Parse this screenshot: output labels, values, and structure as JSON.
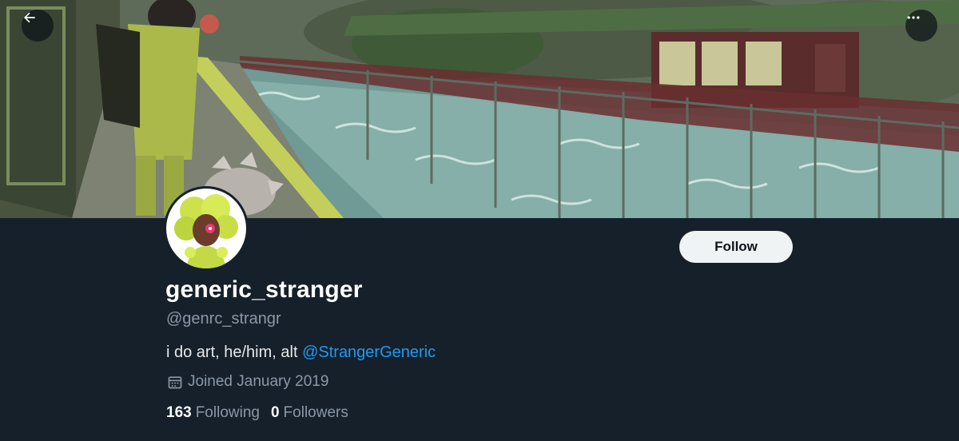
{
  "profile": {
    "display_name": "generic_stranger",
    "handle": "@genrc_strangr",
    "bio_text": "i do art, he/him, alt ",
    "bio_mention": "@StrangerGeneric",
    "joined": "Joined January 2019",
    "follow_label": "Follow"
  },
  "stats": {
    "following_count": "163",
    "following_label": "Following",
    "followers_count": "0",
    "followers_label": "Followers"
  },
  "icons": {
    "back": "arrow-left-icon",
    "more": "more-horizontal-icon",
    "calendar": "calendar-icon"
  },
  "colors": {
    "background": "#15202b",
    "accent": "#1d9bf0",
    "muted_text": "#8b98a5",
    "follow_button_bg": "#eff3f4"
  }
}
